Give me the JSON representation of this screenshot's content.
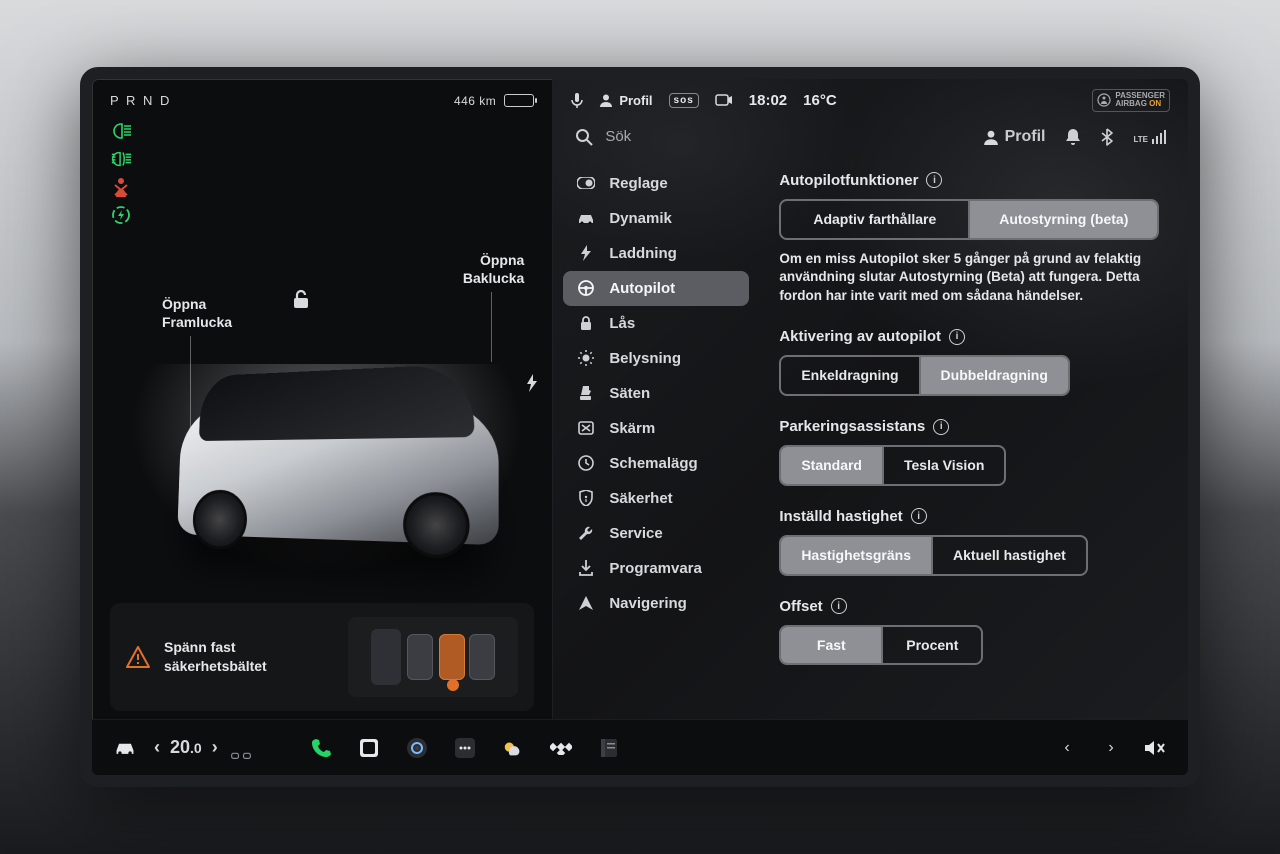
{
  "status": {
    "gear": "P R N D",
    "range": "446 km",
    "profile_label": "Profil",
    "sos": "sos",
    "time": "18:02",
    "temp": "16°C",
    "airbag_line1": "PASSENGER",
    "airbag_line2": "AIRBAG",
    "airbag_state": "ON"
  },
  "subheader": {
    "search_placeholder": "Sök",
    "profile": "Profil",
    "signal": "LTE"
  },
  "car": {
    "frunk": "Öppna\nFramlucka",
    "trunk": "Öppna\nBaklucka",
    "alert": "Spänn fast\nsäkerhetsbältet"
  },
  "nav": {
    "items": [
      "Reglage",
      "Dynamik",
      "Laddning",
      "Autopilot",
      "Lås",
      "Belysning",
      "Säten",
      "Skärm",
      "Schemalägg",
      "Säkerhet",
      "Service",
      "Programvara",
      "Navigering"
    ]
  },
  "autopilot": {
    "functions_title": "Autopilotfunktioner",
    "functions_opts": [
      "Adaptiv farthållare",
      "Autostyrning (beta)"
    ],
    "functions_helper": "Om en miss Autopilot sker 5 gånger på grund av felaktig användning slutar Autostyrning (Beta) att fungera. Detta fordon har inte varit med om sådana händelser.",
    "activation_title": "Aktivering av autopilot",
    "activation_opts": [
      "Enkeldragning",
      "Dubbeldragning"
    ],
    "park_title": "Parkeringsassistans",
    "park_opts": [
      "Standard",
      "Tesla Vision"
    ],
    "speed_title": "Inställd hastighet",
    "speed_opts": [
      "Hastighetsgräns",
      "Aktuell hastighet"
    ],
    "offset_title": "Offset",
    "offset_opts": [
      "Fast",
      "Procent"
    ]
  },
  "bottombar": {
    "temp_whole": "20",
    "temp_dec": ".0"
  }
}
